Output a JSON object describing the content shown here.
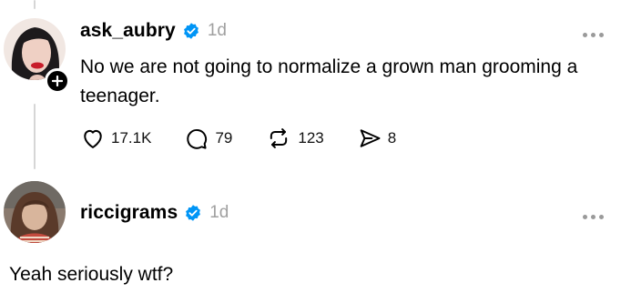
{
  "posts": [
    {
      "username": "ask_aubry",
      "time": "1d",
      "text": "No we are not going to normalize a grown man grooming a teenager.",
      "likes": "17.1K",
      "replies": "79",
      "reposts": "123",
      "shares": "8"
    },
    {
      "username": "riccigrams",
      "time": "1d"
    }
  ],
  "reply_text": "Yeah seriously wtf?",
  "colors": {
    "verified": "#0095f6",
    "muted": "#a0a0a0",
    "thread_line": "#d6d6d6"
  },
  "icons": [
    "heart-icon",
    "comment-icon",
    "repost-icon",
    "share-icon",
    "verified-badge-icon",
    "plus-icon",
    "more-icon"
  ]
}
